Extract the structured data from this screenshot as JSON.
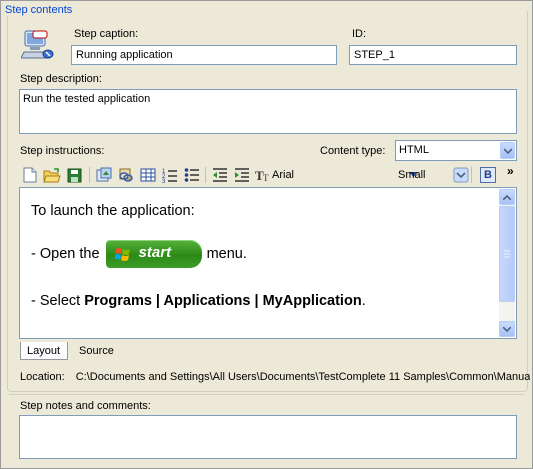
{
  "group": {
    "title": "Step contents"
  },
  "caption": {
    "label": "Step caption:",
    "value": "Running application"
  },
  "id": {
    "label": "ID:",
    "value": "STEP_1"
  },
  "description": {
    "label": "Step description:",
    "value": "Run the tested application"
  },
  "instructions": {
    "label": "Step instructions:",
    "content_type_label": "Content type:",
    "content_type_value": "HTML",
    "font_name": "Arial",
    "font_size": "Small",
    "bold_label": "B",
    "more_label": "»"
  },
  "editor": {
    "line1": "To launch the application:",
    "line2_prefix": "- Open the",
    "start_button": "start",
    "line2_suffix": "menu.",
    "line3_prefix": "- Select",
    "line3_bold": "Programs | Applications | MyApplication",
    "line3_suffix": "."
  },
  "tabs": [
    {
      "label": "Layout"
    },
    {
      "label": "Source"
    }
  ],
  "location": {
    "label": "Location:",
    "value": "C:\\Documents and Settings\\All Users\\Documents\\TestComplete 11 Samples\\Common\\Manual T"
  },
  "notes": {
    "label": "Step notes and comments:",
    "value": ""
  },
  "colors": {
    "accent": "#0046d5",
    "window_bg": "#ece9d8",
    "border": "#7f9db9"
  }
}
